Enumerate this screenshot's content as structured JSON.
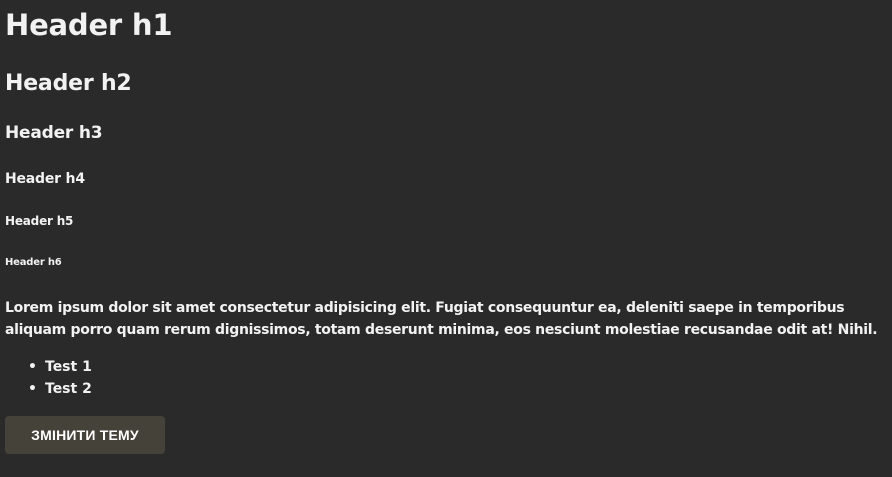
{
  "headers": {
    "h1": "Header h1",
    "h2": "Header h2",
    "h3": "Header h3",
    "h4": "Header h4",
    "h5": "Header h5",
    "h6": "Header h6"
  },
  "paragraph": "Lorem ipsum dolor sit amet consectetur adipisicing elit. Fugiat consequuntur ea, deleniti saepe in temporibus aliquam porro quam rerum dignissimos, totam deserunt minima, eos nesciunt molestiae recusandae odit at! Nihil.",
  "list": {
    "bullet": "•",
    "items": [
      "Test 1",
      "Test 2"
    ]
  },
  "button": {
    "label": "ЗМІНИТИ ТЕМУ"
  },
  "colors": {
    "background": "#2a2a2a",
    "text": "#f2f2f2",
    "button_bg": "#454339"
  }
}
